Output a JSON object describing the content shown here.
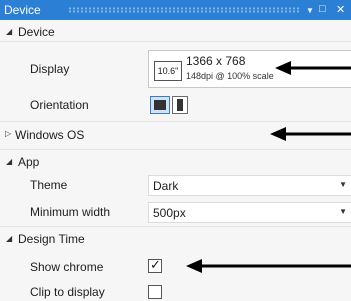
{
  "window": {
    "title": "Device",
    "menu_glyph": "▼",
    "restore_glyph": "□",
    "close_glyph": "✕"
  },
  "sections": {
    "device": {
      "label": "Device",
      "display_label": "Display",
      "display": {
        "size": "10.6\"",
        "resolution": "1366 x 768",
        "detail": "148dpi @ 100% scale"
      },
      "orientation_label": "Orientation"
    },
    "windows_os": {
      "label": "Windows OS"
    },
    "app": {
      "label": "App",
      "theme_label": "Theme",
      "theme_value": "Dark",
      "min_width_label": "Minimum width",
      "min_width_value": "500px"
    },
    "design_time": {
      "label": "Design Time",
      "show_chrome_label": "Show chrome",
      "show_chrome_checked": true,
      "check_glyph": "✓",
      "clip_label": "Clip to display",
      "clip_checked": false
    }
  },
  "colors": {
    "titlebar": "#2b7fd4",
    "background": "#f6f6f6",
    "selected_orientation": "#cfe3f7"
  },
  "icons": [
    "collapse-triangle-icon",
    "expand-triangle-icon",
    "landscape-icon",
    "portrait-icon",
    "dropdown-caret-icon",
    "checkmark-icon",
    "annotation-arrow"
  ]
}
